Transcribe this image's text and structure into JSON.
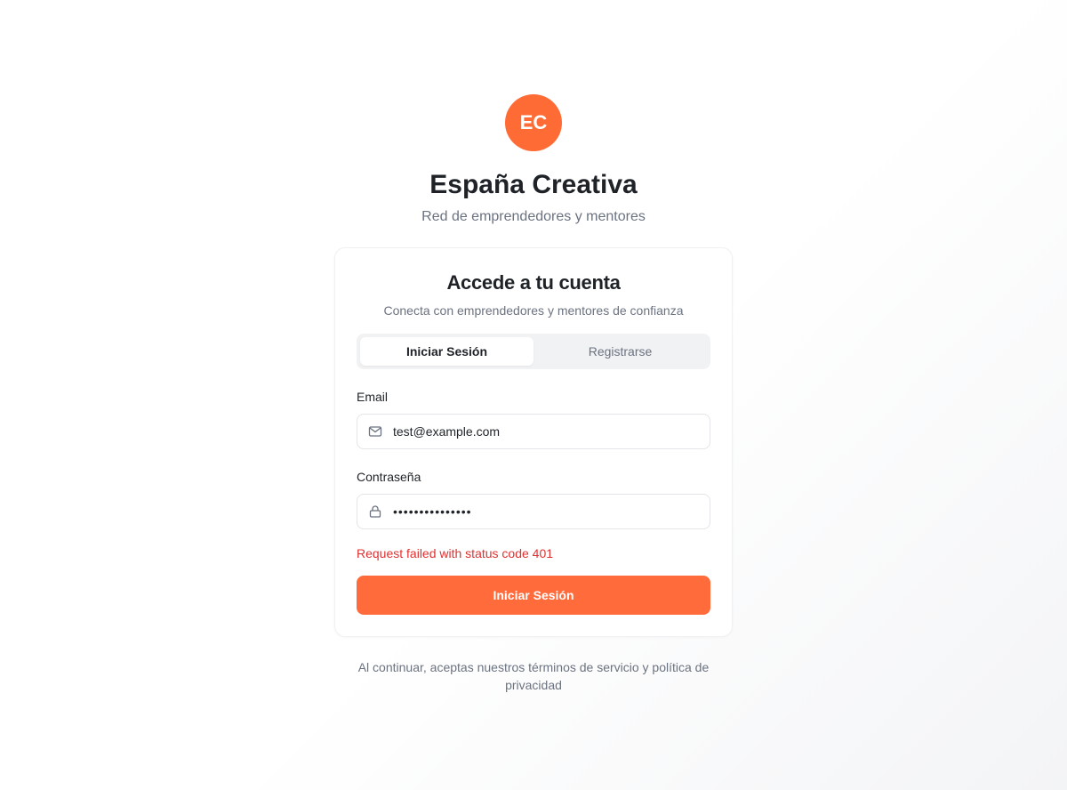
{
  "brand": {
    "initials": "EC",
    "name": "España Creativa",
    "tagline": "Red de emprendedores y mentores",
    "accent_color": "#ff6b35"
  },
  "card": {
    "title": "Accede a tu cuenta",
    "subtitle": "Conecta con emprendedores y mentores de confianza",
    "tabs": [
      {
        "label": "Iniciar Sesión",
        "active": true
      },
      {
        "label": "Registrarse",
        "active": false
      }
    ],
    "email": {
      "label": "Email",
      "value": "test@example.com",
      "icon": "mail-icon"
    },
    "password": {
      "label": "Contraseña",
      "value": "•••••••••••••••",
      "icon": "lock-icon"
    },
    "error": "Request failed with status code 401",
    "error_color": "#e03131",
    "submit_label": "Iniciar Sesión"
  },
  "footer": {
    "terms": "Al continuar, aceptas nuestros términos de servicio y política de privacidad"
  }
}
